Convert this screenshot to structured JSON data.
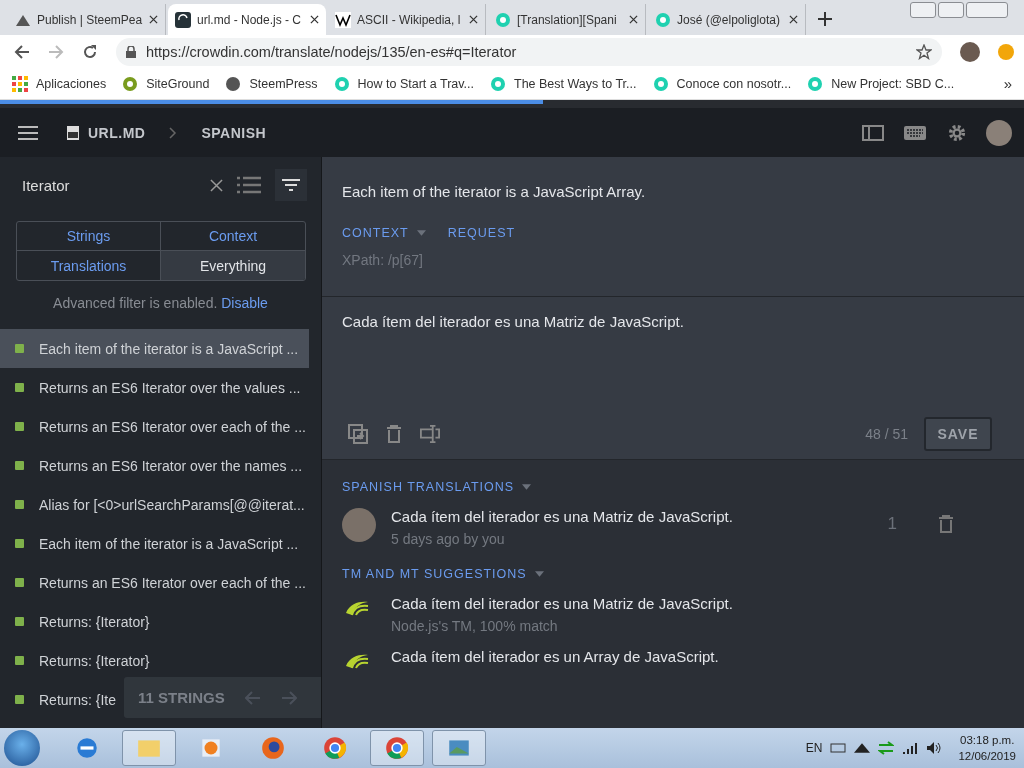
{
  "browser": {
    "tabs": [
      {
        "title": "Publish | SteemPea",
        "selected": false
      },
      {
        "title": "url.md - Node.js - C",
        "selected": true
      },
      {
        "title": "ASCII - Wikipedia, l",
        "selected": false
      },
      {
        "title": "[Translation][Spani",
        "selected": false
      },
      {
        "title": "José (@elpoliglota)",
        "selected": false
      }
    ],
    "url": "https://crowdin.com/translate/nodejs/135/en-es#q=Iterator",
    "bookmarks": [
      {
        "label": "Aplicaciones"
      },
      {
        "label": "SiteGround"
      },
      {
        "label": "SteemPress"
      },
      {
        "label": "How to Start a Trav..."
      },
      {
        "label": "The Best Ways to Tr..."
      },
      {
        "label": "Conoce con nosotr..."
      },
      {
        "label": "New Project: SBD C..."
      }
    ],
    "more": "»",
    "page_load": {
      "level": 0.53
    }
  },
  "header": {
    "file": "URL.MD",
    "language": "SPANISH"
  },
  "sidebar": {
    "search": "Iterator",
    "filters": [
      {
        "label": "Strings",
        "selected": false
      },
      {
        "label": "Context",
        "selected": false
      },
      {
        "label": "Translations",
        "selected": false
      },
      {
        "label": "Everything",
        "selected": true
      }
    ],
    "note": "Advanced filter is enabled.",
    "note_link": "Disable",
    "strings": [
      {
        "text": "Each item of the iterator is a JavaScript ...",
        "selected": true
      },
      {
        "text": "Returns an ES6 Iterator over the values ...",
        "selected": false
      },
      {
        "text": "Returns an ES6 Iterator over each of the ...",
        "selected": false
      },
      {
        "text": "Returns an ES6 Iterator over the names ...",
        "selected": false
      },
      {
        "text": "Alias for [<0>urlSearchParams[@@iterat...",
        "selected": false
      },
      {
        "text": "Each item of the iterator is a JavaScript ...",
        "selected": false
      },
      {
        "text": "Returns an ES6 Iterator over each of the ...",
        "selected": false
      },
      {
        "text": "Returns: {Iterator}",
        "selected": false
      },
      {
        "text": "Returns: {Iterator}",
        "selected": false
      },
      {
        "text": "Returns: {Ite",
        "selected": false
      }
    ],
    "count": "11 STRINGS"
  },
  "editor": {
    "source": "Each item of the iterator is a JavaScript Array.",
    "context": "CONTEXT",
    "request": "REQUEST",
    "xpath": "XPath: /p[67]",
    "translation": "Cada ítem del iterador es una Matriz de JavaScript.",
    "counter": "48 / 51",
    "save": "SAVE"
  },
  "translations": {
    "heading": "SPANISH TRANSLATIONS",
    "items": [
      {
        "text": "Cada ítem del iterador es una Matriz de JavaScript.",
        "meta": "5 days ago by you",
        "votes": "1"
      }
    ]
  },
  "suggestions": {
    "heading": "TM AND MT SUGGESTIONS",
    "items": [
      {
        "text": "Cada ítem del iterador es una Matriz de JavaScript.",
        "meta": "Node.js's TM, 100% match"
      },
      {
        "text": "Cada ítem del iterador es un Array de JavaScript."
      }
    ]
  },
  "taskbar": {
    "lang": "EN",
    "time": "03:18 p.m.",
    "date": "12/06/2019"
  }
}
